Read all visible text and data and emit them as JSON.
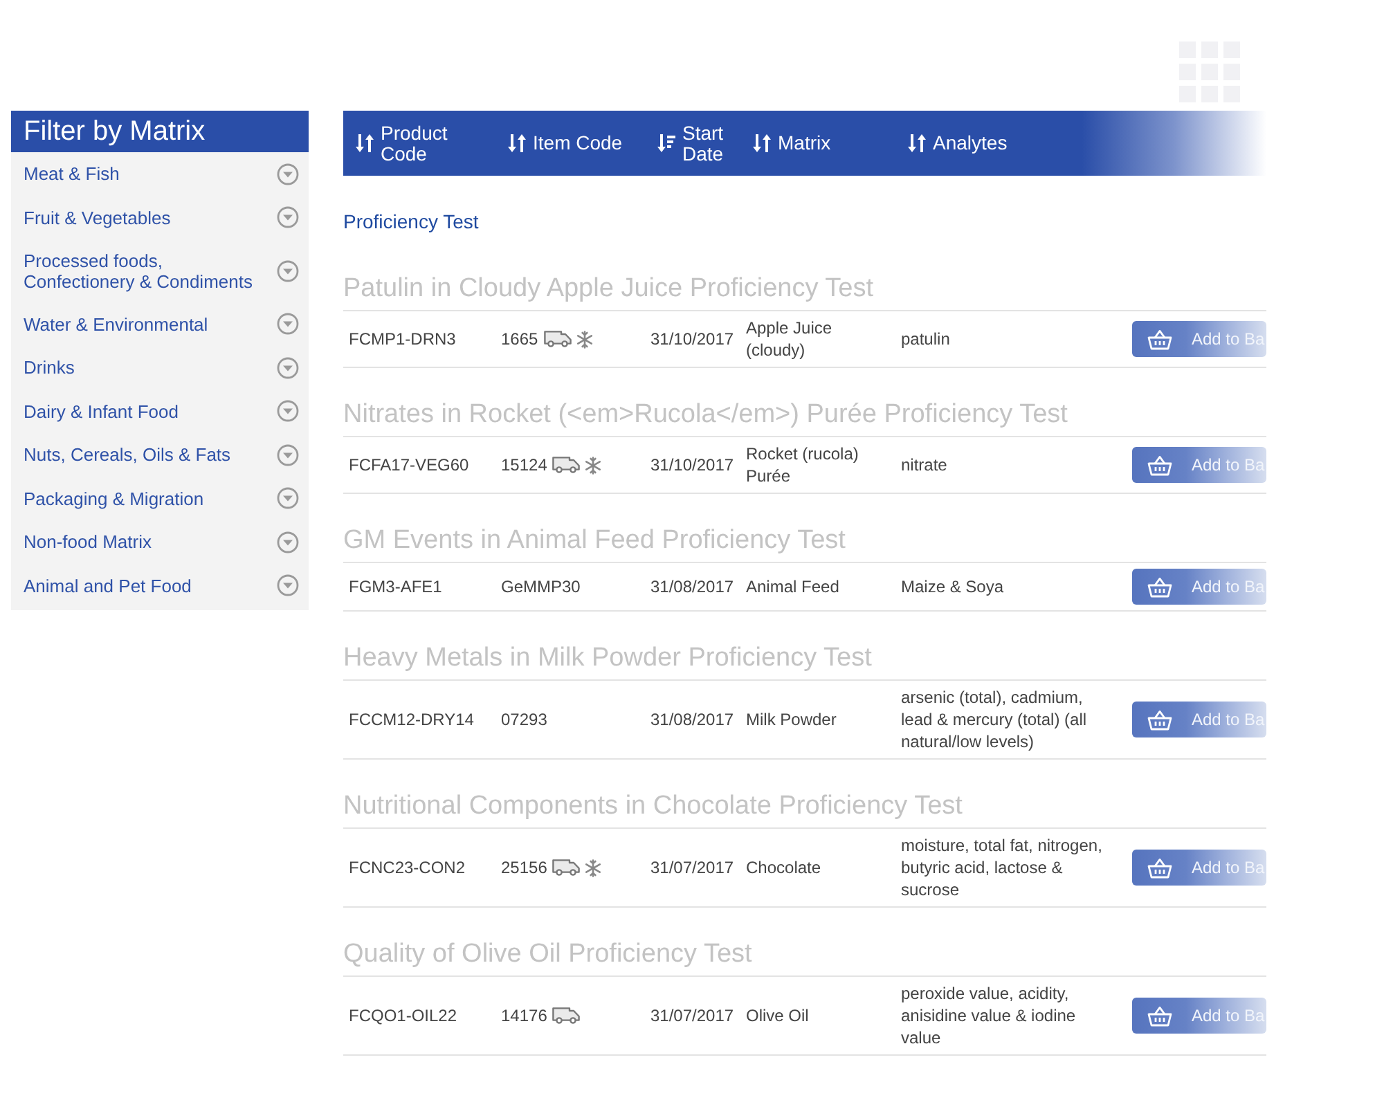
{
  "sidebar": {
    "title": "Filter by Matrix",
    "items": [
      {
        "label": "Meat & Fish",
        "expanded": false
      },
      {
        "label": "Fruit & Vegetables",
        "expanded": false
      },
      {
        "label": "Processed foods, Confectionery & Condiments",
        "expanded": false
      },
      {
        "label": "Water & Environmental",
        "expanded": false
      },
      {
        "label": "Drinks",
        "expanded": false
      },
      {
        "label": "Dairy & Infant Food",
        "expanded": false
      },
      {
        "label": "Nuts, Cereals, Oils & Fats",
        "expanded": false
      },
      {
        "label": "Packaging & Migration",
        "expanded": false
      },
      {
        "label": "Non-food Matrix",
        "expanded": false
      },
      {
        "label": "Animal and Pet Food",
        "expanded": false
      }
    ]
  },
  "table": {
    "columns": [
      {
        "label": "Product Code",
        "sorted": false
      },
      {
        "label": "Item Code",
        "sorted": false
      },
      {
        "label": "Start Date",
        "sorted": true
      },
      {
        "label": "Matrix",
        "sorted": false
      },
      {
        "label": "Analytes",
        "sorted": false
      }
    ],
    "section_label": "Proficiency Test",
    "groups": [
      {
        "title": "Patulin in Cloudy Apple Juice Proficiency Test",
        "row": {
          "product_code": "FCMP1-DRN3",
          "item_code": "1665",
          "shipped": true,
          "frozen": true,
          "start_date": "31/10/2017",
          "matrix": "Apple Juice (cloudy)",
          "analytes": "patulin",
          "button": "Add to Ba"
        }
      },
      {
        "title": "Nitrates in Rocket (<em>Rucola</em>) Purée Proficiency Test",
        "row": {
          "product_code": "FCFA17-VEG60",
          "item_code": "15124",
          "shipped": true,
          "frozen": true,
          "start_date": "31/10/2017",
          "matrix": "Rocket (rucola) Purée",
          "analytes": "nitrate",
          "button": "Add to Ba"
        }
      },
      {
        "title": "GM Events in Animal Feed Proficiency Test",
        "row": {
          "product_code": "FGM3-AFE1",
          "item_code": "GeMMP30",
          "shipped": false,
          "frozen": false,
          "start_date": "31/08/2017",
          "matrix": "Animal Feed",
          "analytes": "Maize & Soya",
          "button": "Add to Ba"
        }
      },
      {
        "title": "Heavy Metals in Milk Powder Proficiency Test",
        "row": {
          "product_code": "FCCM12-DRY14",
          "item_code": "07293",
          "shipped": false,
          "frozen": false,
          "start_date": "31/08/2017",
          "matrix": "Milk Powder",
          "analytes": "arsenic (total), cadmium, lead & mercury (total) (all natural/low levels)",
          "button": "Add to Ba"
        }
      },
      {
        "title": "Nutritional Components in Chocolate Proficiency Test",
        "row": {
          "product_code": "FCNC23-CON2",
          "item_code": "25156",
          "shipped": true,
          "frozen": true,
          "start_date": "31/07/2017",
          "matrix": "Chocolate",
          "analytes": "moisture, total fat, nitrogen, butyric acid, lactose & sucrose",
          "button": "Add to Ba"
        }
      },
      {
        "title": "Quality of Olive Oil Proficiency Test",
        "row": {
          "product_code": "FCQO1-OIL22",
          "item_code": "14176",
          "shipped": true,
          "frozen": false,
          "start_date": "31/07/2017",
          "matrix": "Olive Oil",
          "analytes": "peroxide value, acidity, anisidine value & iodine value",
          "button": "Add to Ba"
        }
      }
    ]
  }
}
